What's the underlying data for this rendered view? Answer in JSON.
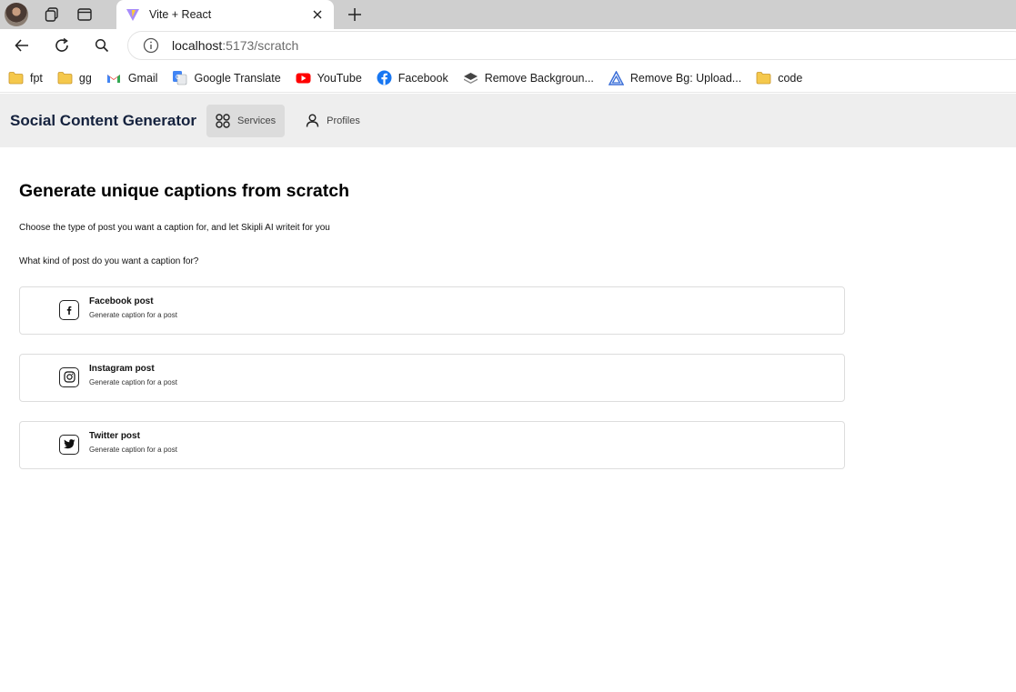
{
  "browser": {
    "tab_title": "Vite + React",
    "url_host": "localhost",
    "url_rest": ":5173/scratch"
  },
  "bookmarks": [
    {
      "label": "fpt",
      "icon": "folder-icon"
    },
    {
      "label": "gg",
      "icon": "folder-icon"
    },
    {
      "label": "Gmail",
      "icon": "gmail-icon"
    },
    {
      "label": "Google Translate",
      "icon": "google-translate-icon"
    },
    {
      "label": "YouTube",
      "icon": "youtube-icon"
    },
    {
      "label": "Facebook",
      "icon": "facebook-icon"
    },
    {
      "label": "Remove Backgroun...",
      "icon": "layers-icon"
    },
    {
      "label": "Remove Bg: Upload...",
      "icon": "triangle-logo-icon"
    },
    {
      "label": "code",
      "icon": "folder-icon"
    }
  ],
  "header": {
    "brand": "Social Content Generator",
    "nav": [
      {
        "label": "Services",
        "icon": "grid-icon",
        "active": true
      },
      {
        "label": "Profiles",
        "icon": "user-icon",
        "active": false
      }
    ]
  },
  "main": {
    "title": "Generate unique captions from scratch",
    "subtitle": "Choose the type of post you want a caption for, and let Skipli AI writeit for you",
    "question": "What kind of post do you want a caption for?",
    "options": [
      {
        "name": "Facebook post",
        "desc": "Generate caption for a post",
        "icon": "facebook-icon"
      },
      {
        "name": "Instagram post",
        "desc": "Generate caption for a post",
        "icon": "instagram-icon"
      },
      {
        "name": "Twitter post",
        "desc": "Generate caption for a post",
        "icon": "twitter-icon"
      }
    ]
  },
  "colors": {
    "brand": "#14213d",
    "header_bg": "#eeeeee",
    "tabstrip_bg": "#cfcfcf"
  }
}
